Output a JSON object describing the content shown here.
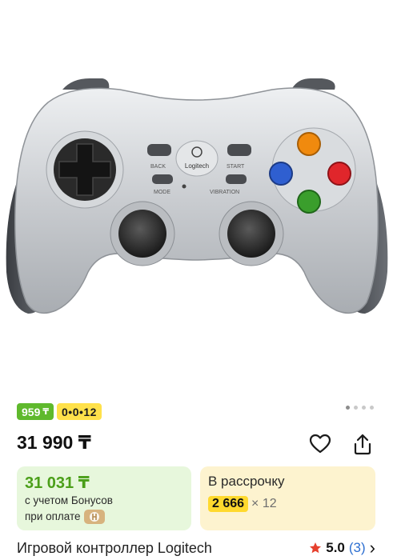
{
  "gallery": {
    "image_icon": "gamepad-controller",
    "logo_text": "Logitech",
    "button_labels": [
      "BACK",
      "START",
      "MODE",
      "VIBRATION"
    ],
    "dots_count": 4,
    "active_dot": 0
  },
  "badges": {
    "price_short": "959",
    "currency_glyph": "₸",
    "installment_code": "0•0•12"
  },
  "price": {
    "value": "31 990 ₸"
  },
  "actions": {
    "favorite_icon": "heart-icon",
    "share_icon": "share-icon"
  },
  "bonus_card": {
    "price": "31 031 ₸",
    "line1": "с учетом Бонусов",
    "line2": "при оплате"
  },
  "installment_card": {
    "title": "В рассрочку",
    "amount": "2 666",
    "multiplier": "× 12"
  },
  "product": {
    "title": "Игровой контроллер Logitech"
  },
  "rating": {
    "score": "5.0",
    "count": "(3)",
    "chevron": "›"
  },
  "colors": {
    "green": "#5fb92c",
    "yellow": "#ffe14a",
    "star": "#e6402d",
    "link": "#2d6fd1"
  }
}
